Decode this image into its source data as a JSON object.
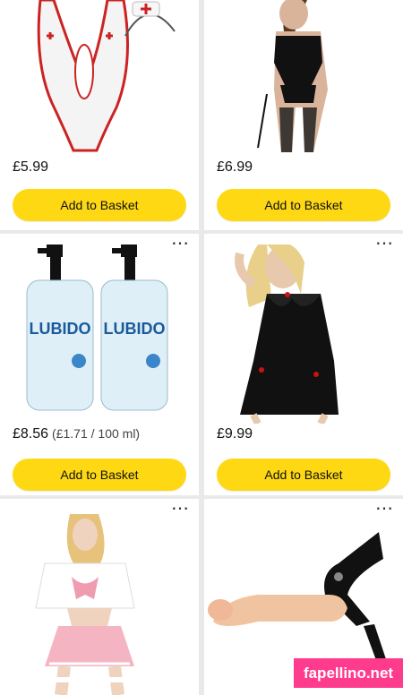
{
  "products": [
    {
      "price": "£5.99",
      "button": "Add to Basket",
      "image": "nurse costume bodysuit with headband"
    },
    {
      "price": "£6.99",
      "button": "Add to Basket",
      "image": "black strappy lingerie with stockings"
    },
    {
      "price": "£8.56",
      "unit_price": "(£1.71 / 100 ml)",
      "button": "Add to Basket",
      "image": "two lubricant pump bottles"
    },
    {
      "price": "£9.99",
      "button": "Add to Basket",
      "image": "black lace babydoll with red bows"
    },
    {
      "image": "pink schoolgirl costume"
    },
    {
      "image": "strap-on harness product"
    }
  ],
  "bottle_label": "LUBIDO",
  "watermark": "fapellino.net",
  "more_icon": "⋯"
}
